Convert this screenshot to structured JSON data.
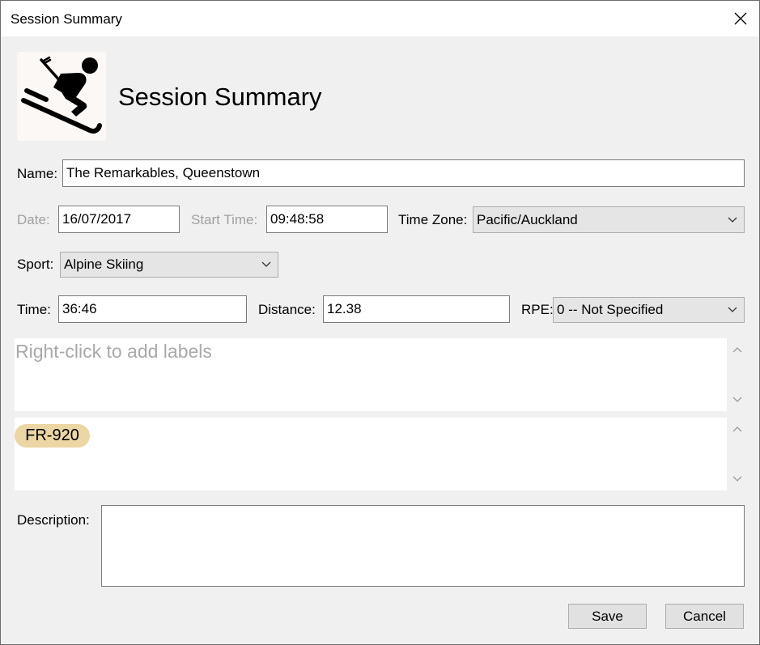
{
  "window": {
    "title": "Session Summary"
  },
  "header": {
    "icon": "skier-icon",
    "heading": "Session Summary"
  },
  "form": {
    "name_label": "Name:",
    "name_value": "The Remarkables, Queenstown",
    "date_label": "Date:",
    "date_value": "16/07/2017",
    "start_time_label": "Start Time:",
    "start_time_value": "09:48:58",
    "timezone_label": "Time Zone:",
    "timezone_value": "Pacific/Auckland",
    "sport_label": "Sport:",
    "sport_value": "Alpine Skiing",
    "time_label": "Time:",
    "time_value": "36:46",
    "distance_label": "Distance:",
    "distance_value": "12.38",
    "rpe_label": "RPE:",
    "rpe_value": "0 -- Not Specified",
    "labels_placeholder": "Right-click to add labels",
    "equipment": [
      "FR-920"
    ],
    "description_label": "Description:",
    "description_value": ""
  },
  "buttons": {
    "save": "Save",
    "cancel": "Cancel"
  },
  "colors": {
    "dialog_bg": "#f0f0f0",
    "chip_bg": "#ecd6a4",
    "placeholder_text": "#a9a9a9",
    "disabled_label": "#a0a0a0"
  }
}
